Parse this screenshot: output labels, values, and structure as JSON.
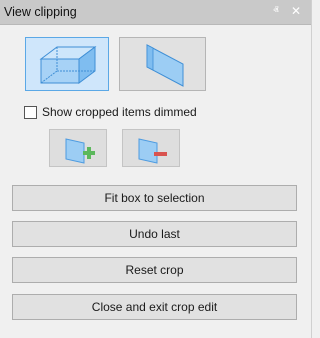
{
  "window": {
    "title": "View clipping",
    "pin_glyph": "ⱏ",
    "close_glyph": "✕"
  },
  "modes": [
    {
      "name": "box",
      "icon": "clip-box-icon",
      "selected": true
    },
    {
      "name": "plane",
      "icon": "clip-plane-icon",
      "selected": false
    }
  ],
  "show_dimmed": {
    "label": "Show cropped items dimmed",
    "checked": false
  },
  "tools": [
    {
      "icon": "add-clip-plane-icon",
      "enabled": false
    },
    {
      "icon": "remove-clip-plane-icon",
      "enabled": false
    }
  ],
  "buttons": {
    "fit": "Fit box to selection",
    "undo": "Undo last",
    "reset": "Reset crop",
    "close": "Close and exit crop edit"
  },
  "colors": {
    "selected_bg": "#cfe6fb",
    "selected_border": "#5ba8e6",
    "add_green": "#5cb85c",
    "remove_red": "#d9534f"
  }
}
